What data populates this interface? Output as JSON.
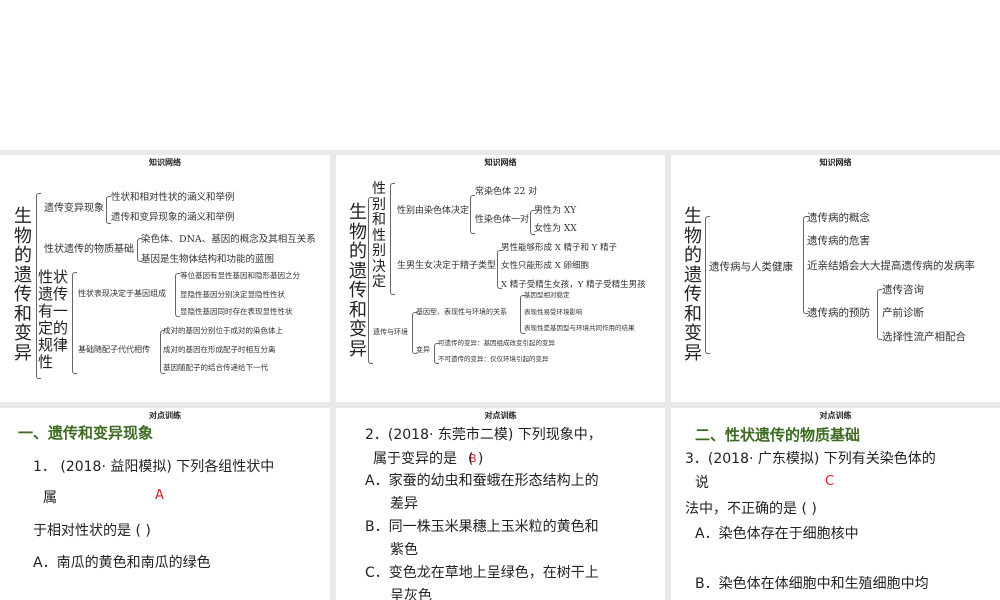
{
  "slides": [
    {
      "title": "知识网络",
      "root": "生物的遗传和变异",
      "b1": {
        "label": "遗传变异现象",
        "items": [
          "性状和相对性状的涵义和举例",
          "遗传和变异现象的涵义和举例"
        ]
      },
      "b2": {
        "label": "性状遗传的物质基础",
        "items": [
          "染色体、DNA、基因的概念及其相互关系",
          "基因是生物体结构和功能的蓝图"
        ]
      },
      "b3": {
        "label": "性状遗传有一定的规律性",
        "c1": {
          "label": "性状表现决定于基因组成",
          "items": [
            "等位基因有显性基因和隐形基因之分",
            "显隐性基因分别决定显隐性性状",
            "显隐性基因同时存在表现显性性状"
          ]
        },
        "c2": {
          "label": "基础随配子代代相传",
          "items": [
            "成对的基因分别位于成对的染色体上",
            "成对的基因在形成配子时相互分离",
            "基因随配子的结合传递给下一代"
          ]
        }
      }
    },
    {
      "title": "知识网络",
      "root": "生物的遗传和变异",
      "b1": {
        "label": "性别和性别决定",
        "c1": {
          "label": "性别由染色体决定",
          "items": [
            "常染色体 22 对",
            "性染色体一对"
          ],
          "sub": [
            "男性为 XY",
            "女性为 XX"
          ]
        },
        "c2": {
          "label": "生男生女决定于精子类型",
          "items": [
            "男性能够形成 X 精子和 Y 精子",
            "女性只能形成 X 卵细胞",
            "X 精子受精生女孩，Y 精子受精生男孩"
          ]
        }
      },
      "b2": {
        "label": "遗传与环境",
        "c1": {
          "label": "基因型、表现性与环境的关系",
          "items": [
            "基因型相对稳定",
            "表现性易受环境影响",
            "表现性是基因型与环境共同作用的结果"
          ]
        },
        "c2": {
          "label": "变异",
          "items": [
            "可遗传的变异：基因组成改变引起的变异",
            "不可遗传的变异：仅仅环境引起的变异"
          ]
        }
      }
    },
    {
      "title": "知识网络",
      "root": "生物的遗传和变异",
      "b1": {
        "label": "遗传病与人类健康",
        "items": [
          "遗传病的概念",
          "遗传病的危害",
          "近亲结婚会大大提高遗传病的发病率",
          "遗传病的预防"
        ],
        "sub": [
          "遗传咨询",
          "产前诊断",
          "选择性流产相配合"
        ]
      }
    },
    {
      "title": "对点训练",
      "heading": "一、遗传和变异现象",
      "lines": [
        "1．  (2018· 益阳模拟) 下列各组性状中",
        "属",
        "于相对性状的是 (        )",
        "A．南瓜的黄色和南瓜的绿色"
      ],
      "answer": "A"
    },
    {
      "title": "对点训练",
      "lines": [
        "2．(2018· 东莞市二模) 下列现象中，",
        "属于变异的是",
        "(        )",
        "A．家蚕的幼虫和蚕蛾在形态结构上的",
        "差异",
        "B．同一株玉米果穗上玉米粒的黄色和",
        "紫色",
        "C．变色龙在草地上呈绿色，在树干上",
        "呈灰色"
      ],
      "answer": "B"
    },
    {
      "title": "对点训练",
      "heading": "二、性状遗传的物质基础",
      "lines": [
        "3．(2018· 广东模拟) 下列有关染色体的",
        "说",
        "法中，不正确的是 (       )",
        "A．染色体存在于细胞核中",
        "B．染色体在体细胞中和生殖细胞中均"
      ],
      "answer": "C"
    }
  ]
}
